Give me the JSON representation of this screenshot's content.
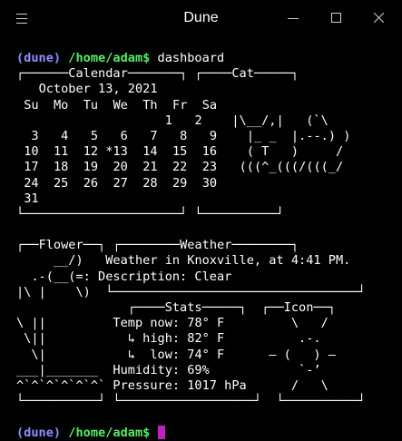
{
  "window": {
    "title": "Dune",
    "menu_icon": "hamburger-menu-icon",
    "minimize_icon": "minimize-icon",
    "maximize_icon": "maximize-icon",
    "close_icon": "close-icon"
  },
  "prompt1": {
    "env": "(dune)",
    "path": "/home/adam",
    "symbol": "$",
    "command": "dashboard"
  },
  "calendar": {
    "title": "Calendar",
    "month_line": "October 13, 2021",
    "days": [
      "Su",
      "Mo",
      "Tu",
      "We",
      "Th",
      "Fr",
      "Sa"
    ],
    "weeks": [
      [
        "",
        "",
        "",
        "",
        "",
        "1",
        "2"
      ],
      [
        "3",
        "4",
        "5",
        "6",
        "7",
        "8",
        "9"
      ],
      [
        "10",
        "11",
        "12",
        "*13",
        "14",
        "15",
        "16"
      ],
      [
        "17",
        "18",
        "19",
        "20",
        "21",
        "22",
        "23"
      ],
      [
        "24",
        "25",
        "26",
        "27",
        "28",
        "29",
        "30"
      ],
      [
        "31",
        "",
        "",
        "",
        "",
        "",
        ""
      ]
    ]
  },
  "cat": {
    "title": "Cat",
    "art": [
      "|\\__/,|   (`\\",
      "|_ _  |.--.) )",
      "( T   )     /",
      "(((^_(((/(((_/"
    ]
  },
  "flower": {
    "title": "Flower",
    "art": [
      "     __/)",
      "  .-(__(=:",
      "|\\ |    \\)",
      "\\ ||",
      " \\||",
      "  \\|",
      "___|_______",
      "^`^`^`^`^`^`"
    ]
  },
  "weather": {
    "title": "Weather",
    "location_line": "Weather in Knoxville, at 4:41 PM.",
    "description_line": "Description: Clear"
  },
  "stats": {
    "title": "Stats",
    "lines": [
      "Temp now: 78° F",
      "  ↳ high: 82° F",
      "  ↳  low: 74° F",
      "Humidity: 69%",
      "Pressure: 1017 hPa"
    ]
  },
  "icon_panel": {
    "title": "Icon",
    "art": [
      "  \\   /",
      "   .-.",
      "― (   ) ―",
      "   `-’",
      "  /   \\"
    ]
  },
  "prompt2": {
    "env": "(dune)",
    "path": "/home/adam",
    "symbol": "$"
  }
}
